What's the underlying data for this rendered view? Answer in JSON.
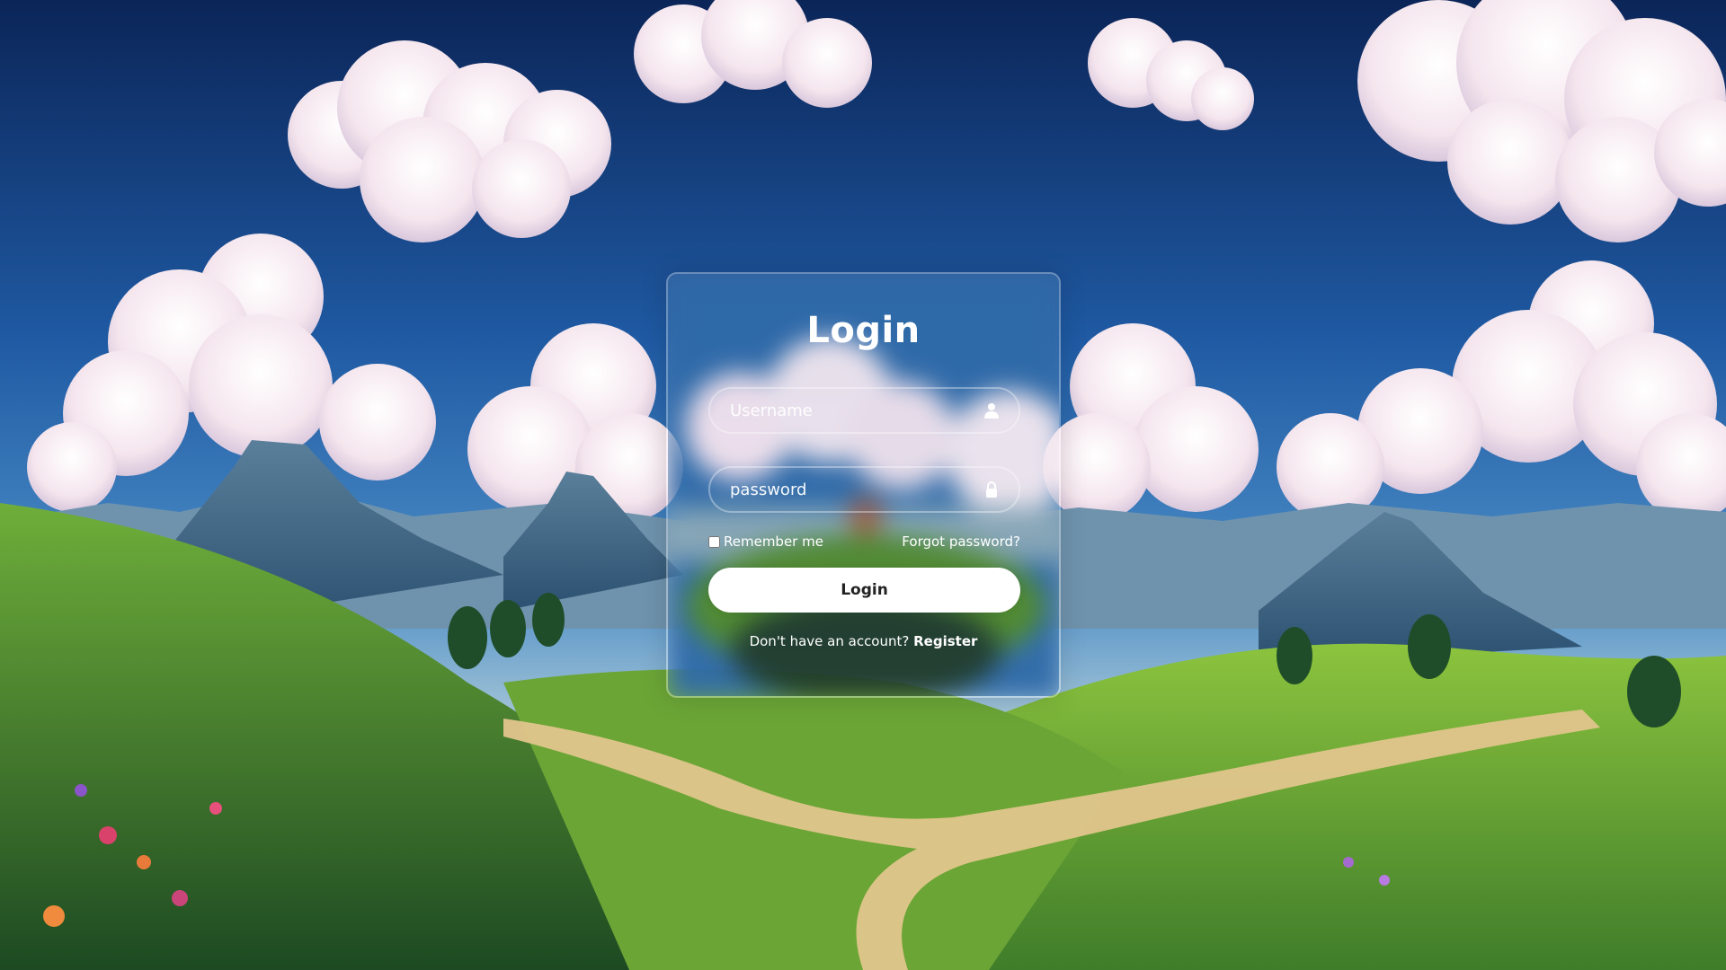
{
  "scene": {
    "description_icon": "landscape-background",
    "sky_top": "#0e2c63",
    "sky_mid": "#2a6cb5",
    "horizon": "#a9c8d8",
    "grass_light": "#7fb63a",
    "grass_dark": "#2f6a2a",
    "path": "#e2c58c"
  },
  "login": {
    "title": "Login",
    "username_placeholder": "Username",
    "password_placeholder": "password",
    "remember_label": "Remember me",
    "forgot_label": "Forgot password?",
    "button_label": "Login",
    "register_prompt": "Don't have an account?",
    "register_link": "Register",
    "username_icon": "user-icon",
    "password_icon": "lock-icon"
  }
}
